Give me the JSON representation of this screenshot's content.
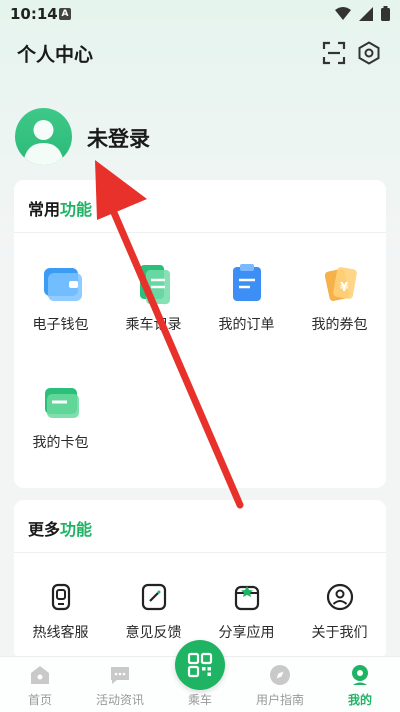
{
  "status_bar": {
    "time": "10:14",
    "notification_badge": "A",
    "icons": [
      "wifi-icon",
      "signal-icon",
      "battery-icon"
    ]
  },
  "header": {
    "title": "个人中心",
    "icons": [
      "scan-icon",
      "settings-icon"
    ]
  },
  "user": {
    "login_status": "未登录",
    "avatar_icon": "avatar-icon"
  },
  "common_functions": {
    "title_prefix": "常用",
    "title_accent": "功能",
    "items": [
      {
        "label": "电子钱包",
        "icon": "wallet-icon"
      },
      {
        "label": "乘车记录",
        "icon": "ride-record-icon"
      },
      {
        "label": "我的订单",
        "icon": "order-icon"
      },
      {
        "label": "我的券包",
        "icon": "coupon-icon"
      },
      {
        "label": "我的卡包",
        "icon": "card-icon"
      }
    ]
  },
  "more_functions": {
    "title_prefix": "更多",
    "title_accent": "功能",
    "items": [
      {
        "label": "热线客服",
        "icon": "hotline-icon"
      },
      {
        "label": "意见反馈",
        "icon": "feedback-icon"
      },
      {
        "label": "分享应用",
        "icon": "share-icon"
      },
      {
        "label": "关于我们",
        "icon": "about-icon"
      }
    ]
  },
  "bottom_nav": {
    "items": [
      {
        "label": "首页",
        "icon": "home-icon"
      },
      {
        "label": "活动资讯",
        "icon": "chat-icon"
      },
      {
        "label": "乘车",
        "icon": "qr-code-icon"
      },
      {
        "label": "用户指南",
        "icon": "compass-icon"
      },
      {
        "label": "我的",
        "icon": "profile-icon"
      }
    ],
    "active": "我的"
  },
  "colors": {
    "accent": "#1fb463",
    "annotation_arrow": "#e8312a",
    "inactive": "#999999"
  }
}
